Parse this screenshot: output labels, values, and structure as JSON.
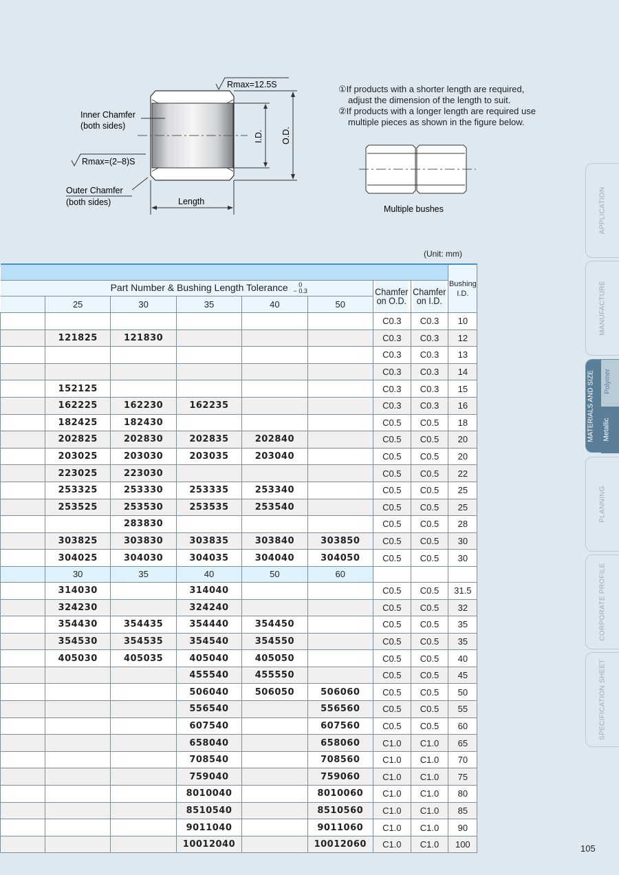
{
  "diagram": {
    "rmax_top": "Rmax=12.5S",
    "inner_chamfer": "Inner Chamfer",
    "both_sides": "(both sides)",
    "rmax_left": "Rmax=(2–8)S",
    "outer_chamfer": "Outer Chamfer",
    "length": "Length",
    "id": "I.D.",
    "od": "O.D.",
    "multiple_bushes": "Multiple bushes"
  },
  "notes": [
    "①If products with a shorter length are required,",
    "adjust the dimension of the length to suit.",
    "②If products with a longer length are required use",
    "multiple pieces as shown in the figure below."
  ],
  "unit": "(Unit: mm)",
  "table": {
    "header_title": "Part Number & Bushing Length Tolerance",
    "tol_upper": "0",
    "tol_lower": "− 0.3",
    "chamfer_od": [
      "Chamfer",
      "on O.D."
    ],
    "chamfer_id": [
      "Chamfer",
      "on I.D."
    ],
    "bushing_id": [
      "Bushing",
      "I.D."
    ],
    "lengths_a": [
      "25",
      "30",
      "35",
      "40",
      "50"
    ],
    "rows_a": [
      {
        "p": [
          "",
          "",
          "",
          "",
          ""
        ],
        "od": "C0.3",
        "ic": "C0.3",
        "id": "10"
      },
      {
        "p": [
          "121825",
          "121830",
          "",
          "",
          ""
        ],
        "od": "C0.3",
        "ic": "C0.3",
        "id": "12"
      },
      {
        "p": [
          "",
          "",
          "",
          "",
          ""
        ],
        "od": "C0.3",
        "ic": "C0.3",
        "id": "13"
      },
      {
        "p": [
          "",
          "",
          "",
          "",
          ""
        ],
        "od": "C0.3",
        "ic": "C0.3",
        "id": "14"
      },
      {
        "p": [
          "152125",
          "",
          "",
          "",
          ""
        ],
        "od": "C0.3",
        "ic": "C0.3",
        "id": "15"
      },
      {
        "p": [
          "162225",
          "162230",
          "162235",
          "",
          ""
        ],
        "od": "C0.3",
        "ic": "C0.3",
        "id": "16"
      },
      {
        "p": [
          "182425",
          "182430",
          "",
          "",
          ""
        ],
        "od": "C0.5",
        "ic": "C0.5",
        "id": "18"
      },
      {
        "p": [
          "202825",
          "202830",
          "202835",
          "202840",
          ""
        ],
        "od": "C0.5",
        "ic": "C0.5",
        "id": "20"
      },
      {
        "p": [
          "203025",
          "203030",
          "203035",
          "203040",
          ""
        ],
        "od": "C0.5",
        "ic": "C0.5",
        "id": "20"
      },
      {
        "p": [
          "223025",
          "223030",
          "",
          "",
          ""
        ],
        "od": "C0.5",
        "ic": "C0.5",
        "id": "22"
      },
      {
        "p": [
          "253325",
          "253330",
          "253335",
          "253340",
          ""
        ],
        "od": "C0.5",
        "ic": "C0.5",
        "id": "25"
      },
      {
        "p": [
          "253525",
          "253530",
          "253535",
          "253540",
          ""
        ],
        "od": "C0.5",
        "ic": "C0.5",
        "id": "25"
      },
      {
        "p": [
          "",
          "283830",
          "",
          "",
          ""
        ],
        "od": "C0.5",
        "ic": "C0.5",
        "id": "28"
      },
      {
        "p": [
          "303825",
          "303830",
          "303835",
          "303840",
          "303850"
        ],
        "od": "C0.5",
        "ic": "C0.5",
        "id": "30"
      },
      {
        "p": [
          "304025",
          "304030",
          "304035",
          "304040",
          "304050"
        ],
        "od": "C0.5",
        "ic": "C0.5",
        "id": "30"
      }
    ],
    "lengths_b": [
      "30",
      "35",
      "40",
      "50",
      "60"
    ],
    "rows_b": [
      {
        "p": [
          "314030",
          "",
          "314040",
          "",
          ""
        ],
        "od": "C0.5",
        "ic": "C0.5",
        "id": "31.5"
      },
      {
        "p": [
          "324230",
          "",
          "324240",
          "",
          ""
        ],
        "od": "C0.5",
        "ic": "C0.5",
        "id": "32"
      },
      {
        "p": [
          "354430",
          "354435",
          "354440",
          "354450",
          ""
        ],
        "od": "C0.5",
        "ic": "C0.5",
        "id": "35"
      },
      {
        "p": [
          "354530",
          "354535",
          "354540",
          "354550",
          ""
        ],
        "od": "C0.5",
        "ic": "C0.5",
        "id": "35"
      },
      {
        "p": [
          "405030",
          "405035",
          "405040",
          "405050",
          ""
        ],
        "od": "C0.5",
        "ic": "C0.5",
        "id": "40"
      },
      {
        "p": [
          "",
          "",
          "455540",
          "455550",
          ""
        ],
        "od": "C0.5",
        "ic": "C0.5",
        "id": "45"
      },
      {
        "p": [
          "",
          "",
          "506040",
          "506050",
          "506060"
        ],
        "od": "C0.5",
        "ic": "C0.5",
        "id": "50"
      },
      {
        "p": [
          "",
          "",
          "556540",
          "",
          "556560"
        ],
        "od": "C0.5",
        "ic": "C0.5",
        "id": "55"
      },
      {
        "p": [
          "",
          "",
          "607540",
          "",
          "607560"
        ],
        "od": "C0.5",
        "ic": "C0.5",
        "id": "60"
      },
      {
        "p": [
          "",
          "",
          "658040",
          "",
          "658060"
        ],
        "od": "C1.0",
        "ic": "C1.0",
        "id": "65"
      },
      {
        "p": [
          "",
          "",
          "708540",
          "",
          "708560"
        ],
        "od": "C1.0",
        "ic": "C1.0",
        "id": "70"
      },
      {
        "p": [
          "",
          "",
          "759040",
          "",
          "759060"
        ],
        "od": "C1.0",
        "ic": "C1.0",
        "id": "75"
      },
      {
        "p": [
          "",
          "",
          "8010040",
          "",
          "8010060"
        ],
        "od": "C1.0",
        "ic": "C1.0",
        "id": "80"
      },
      {
        "p": [
          "",
          "",
          "8510540",
          "",
          "8510560"
        ],
        "od": "C1.0",
        "ic": "C1.0",
        "id": "85"
      },
      {
        "p": [
          "",
          "",
          "9011040",
          "",
          "9011060"
        ],
        "od": "C1.0",
        "ic": "C1.0",
        "id": "90"
      },
      {
        "p": [
          "",
          "",
          "10012040",
          "",
          "10012060"
        ],
        "od": "C1.0",
        "ic": "C1.0",
        "id": "100"
      }
    ]
  },
  "tabs": {
    "application": "APPLICATION",
    "manufacture": "MANUFACTURE",
    "materials": "MATERIALS AND SIZE",
    "polymer": "Polymer",
    "metallic": "Metallic",
    "planning": "PLANNING",
    "corporate": "CORPORATE PROFILE",
    "spec": "SPECIFICATION SHEET"
  },
  "page_number": "105"
}
